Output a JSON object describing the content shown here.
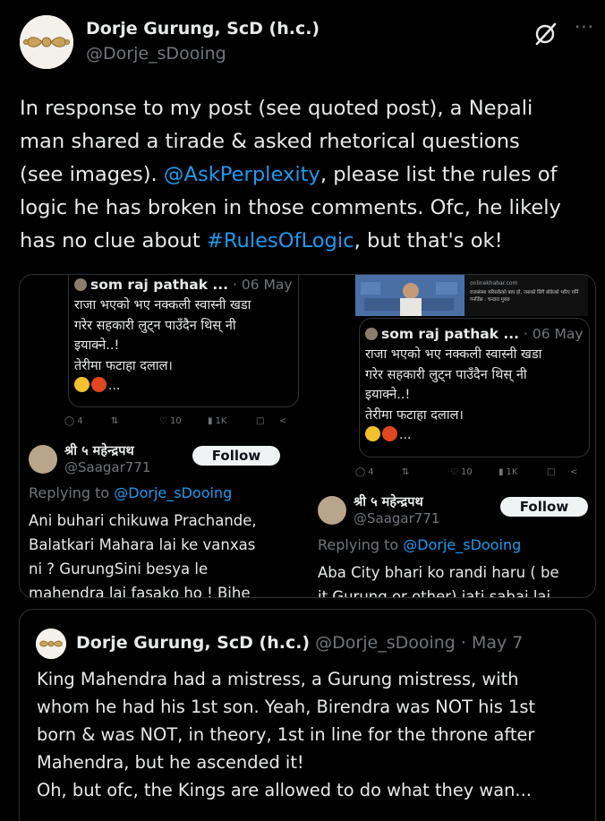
{
  "post": {
    "author_name": "Dorje Gurung, ScD (h.c.)",
    "author_handle": "@Dorje_sDooing",
    "text": {
      "line1": "In response to my post (see quoted post), a Nepali",
      "line2": "man shared a tirade & asked rhetorical questions",
      "line3_a": "(see images). ",
      "line3_link": "@AskPerplexity",
      "line3_b": ", please list the rules of",
      "line4": "logic he has broken in those comments. Ofc, he likely",
      "line5_a": "has no clue about ",
      "line5_link": "#RulesOfLogic",
      "line5_b": ", but that's ok!"
    },
    "icons": {
      "grok": "grok-icon",
      "more": "more-icon",
      "more_glyph": "···"
    }
  },
  "media": {
    "left": {
      "inner": {
        "name": "som raj pathak ...",
        "date": " · 06 May",
        "lines": [
          "राजा भएको भए नक्कली स्वास्नी खडा",
          "गरेर सहकारी लुट्न पाउँदैन थिस् नी",
          "इयाक्ने..!",
          "तेरीमा फटाहा दलाल।"
        ],
        "emoji_suffix": "..."
      },
      "actions": {
        "replies": "4",
        "views": "10",
        "analytics": "1K"
      },
      "reply": {
        "name": "श्री ५ महेन्द्रपथ",
        "handle": "@Saagar771",
        "follow": "Follow",
        "replying_prefix": "Replying to ",
        "replying_link": "@Dorje_sDooing",
        "lines": [
          "Ani buhari chikuwa Prachande,",
          "Balatkari Mahara lai ke vanxas",
          "ni ? GurungSini besya le",
          "mahendra lai fasako ho ! Bihe"
        ]
      }
    },
    "right": {
      "strip": {
        "site": "onlinekhabar.com",
        "caption": "राजसंस्था मरिसकेको बाघ हो, जसको सिंगै बोकेको भरिए गर्नि गर्नाउँछ : चन्दारा गुरुङ"
      },
      "inner": {
        "name": "som raj pathak ...",
        "date": " · 06 May",
        "lines": [
          "राजा भएको भए नक्कली स्वास्नी खडा",
          "गरेर सहकारी लुट्न पाउँदैन थिस् नी",
          "इयाक्ने..!",
          "तेरीमा फटाहा दलाल।"
        ],
        "emoji_suffix": "..."
      },
      "actions": {
        "replies": "4",
        "views": "10",
        "analytics": "1K"
      },
      "reply": {
        "name": "श्री ५ महेन्द्रपथ",
        "handle": "@Saagar771",
        "follow": "Follow",
        "replying_prefix": "Replying to ",
        "replying_link": "@Dorje_sDooing",
        "lines": [
          "Aba City bhari ko randi haru ( be",
          "it Gurung or other) jati sabai lai"
        ]
      }
    }
  },
  "quote": {
    "name": "Dorje Gurung, ScD (h.c.)",
    "meta": " @Dorje_sDooing · May 7",
    "lines": [
      "King Mahendra had a mistress, a Gurung mistress, with",
      "whom he had his 1st son. Yeah, Birendra was NOT his 1st",
      "born & was NOT, in theory, 1st in line for the throne after",
      "Mahendra, but he ascended it!",
      "Oh, but ofc, the Kings are allowed to do what they wan..."
    ]
  },
  "colors": {
    "background": "#000000",
    "text": "#e7e9ea",
    "muted": "#71767b",
    "link": "#1d9bf0",
    "border": "#2f3336"
  }
}
